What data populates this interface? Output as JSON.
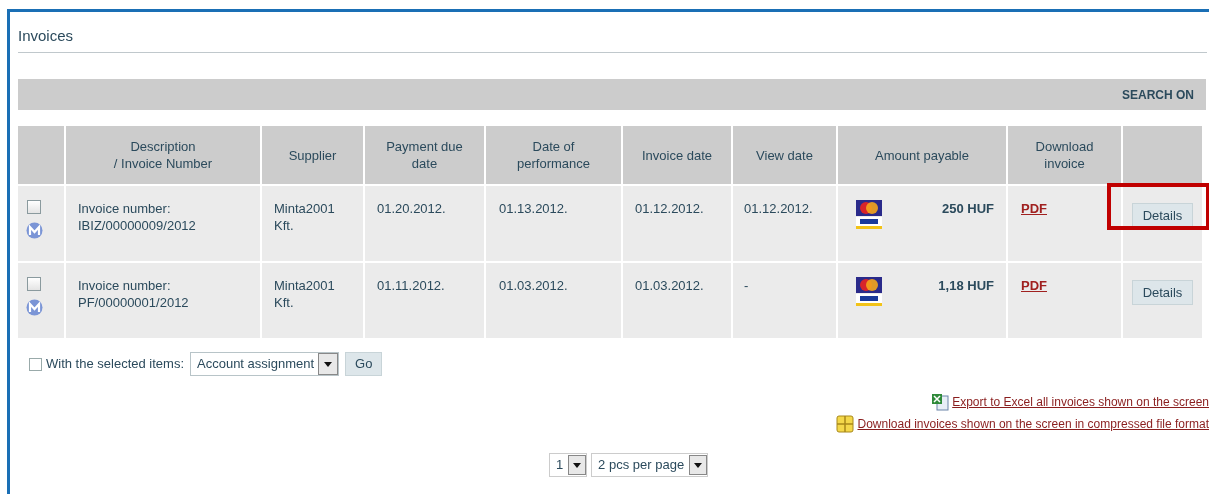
{
  "title": "Invoices",
  "search_toggle": "SEARCH ON",
  "columns": [
    "",
    "Description\n/ Invoice Number",
    "Supplier",
    "Payment due date",
    "Date of performance",
    "Invoice date",
    "View date",
    "Amount payable",
    "Download invoice",
    ""
  ],
  "rows": [
    {
      "checked": false,
      "description": "Invoice number:",
      "invoice_number": "IBIZ/00000009/2012",
      "supplier": "Minta2001 Kft.",
      "payment_due": "01.20.2012.",
      "performance": "01.13.2012.",
      "invoice_date": "01.12.2012.",
      "view_date": "01.12.2012.",
      "amount": "250 HUF",
      "download": "PDF",
      "action": "Details",
      "highlighted": true
    },
    {
      "checked": false,
      "description": "Invoice number:",
      "invoice_number": "PF/00000001/2012",
      "supplier": "Minta2001 Kft.",
      "payment_due": "01.11.2012.",
      "performance": "01.03.2012.",
      "invoice_date": "01.03.2012.",
      "view_date": "-",
      "amount": "1,18 HUF",
      "download": "PDF",
      "action": "Details",
      "highlighted": false
    }
  ],
  "bulk": {
    "checked": false,
    "label": "With the selected items:",
    "action": "Account assignment",
    "button": "Go"
  },
  "links": [
    {
      "kind": "excel",
      "text": "Export to Excel all invoices shown on the screen"
    },
    {
      "kind": "archive",
      "text": "Download invoices shown on the screen in compressed file format"
    }
  ],
  "pagination": {
    "page": "1",
    "per_page": "2 pcs per page"
  }
}
